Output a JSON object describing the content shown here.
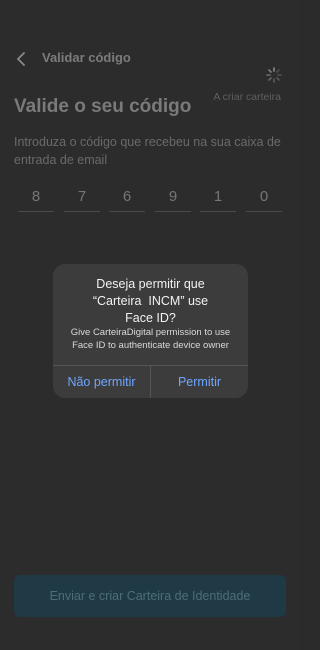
{
  "header": {
    "back_icon": "chevron-left-icon",
    "title": "Validar código"
  },
  "status": {
    "icon": "spinner-icon",
    "text": "A criar carteira"
  },
  "main": {
    "title": "Valide o seu código",
    "subtitle": "Introduza o código que recebeu na sua caixa de entrada de email",
    "code_digits": [
      "8",
      "7",
      "6",
      "9",
      "1",
      "0"
    ]
  },
  "dialog": {
    "title_line1": "Deseja permitir que",
    "title_line2": "“Carteira  INCM” use",
    "title_line3": "Face ID?",
    "message": "Give CarteiraDigital permission to use Face ID to authenticate device owner",
    "deny_label": "Não permitir",
    "allow_label": "Permitir"
  },
  "footer": {
    "submit_label": "Enviar e criar Carteira de Identidade"
  },
  "colors": {
    "background": "#2c2c2c",
    "dialog_background": "#3c3c3c",
    "dialog_button": "#6ea6ff",
    "submit_background": "#1f3a44"
  }
}
